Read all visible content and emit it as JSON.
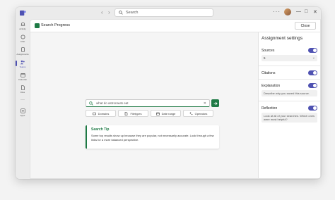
{
  "titlebar": {
    "search_placeholder": "Search",
    "back_glyph": "‹",
    "forward_glyph": "›",
    "more_glyph": "···",
    "minimize_glyph": "—",
    "maximize_glyph": "□",
    "close_glyph": "✕"
  },
  "rail": {
    "items": [
      {
        "label": "Activity",
        "icon": "bell-icon"
      },
      {
        "label": "Chat",
        "icon": "chat-icon"
      },
      {
        "label": "Assignments",
        "icon": "assignments-icon"
      },
      {
        "label": "Teams",
        "icon": "teams-icon"
      },
      {
        "label": "Calendar",
        "icon": "calendar-icon"
      },
      {
        "label": "Files",
        "icon": "files-icon"
      },
      {
        "label": "Apps",
        "icon": "apps-icon"
      }
    ],
    "more_glyph": "···"
  },
  "app": {
    "title": "Search Progress",
    "close_label": "Close"
  },
  "search": {
    "query": "what do astronauts eat",
    "clear_glyph": "✕"
  },
  "filters": [
    {
      "label": "Domains",
      "icon": "domains-icon"
    },
    {
      "label": "Filetypes",
      "icon": "filetypes-icon"
    },
    {
      "label": "Date range",
      "icon": "calendar-icon"
    },
    {
      "label": "Operators",
      "icon": "plus-minus-icon"
    }
  ],
  "tip": {
    "title": "Search Tip",
    "body": "Some top results show up because they are popular, not necessarily accurate. Look through a few links for a more balanced perspective."
  },
  "panel": {
    "title": "Assignment settings",
    "sources_label": "Sources",
    "sources_value": "5",
    "citations_label": "Citations",
    "explanation_label": "Explanation",
    "explanation_prompt": "Describe why you saved this source.",
    "reflection_label": "Reflection",
    "reflection_prompt": "Look at all of your searches. Which ones were most helpful?"
  },
  "colors": {
    "accent_green": "#1e7a45",
    "toggle_purple": "#4f52b2"
  }
}
